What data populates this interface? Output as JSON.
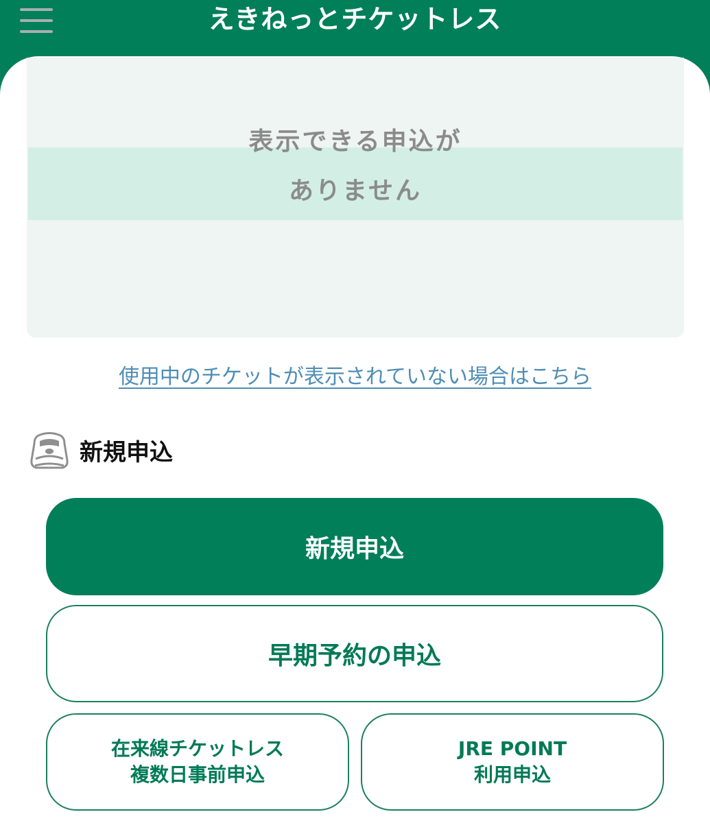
{
  "header": {
    "title": "えきねっとチケットレス",
    "menu_icon": "hamburger-menu-icon",
    "background_color": "#007f58"
  },
  "ticket_list": {
    "empty_message_line1": "表示できる申込が",
    "empty_message_line2": "ありません"
  },
  "help_link": {
    "label": "使用中のチケットが表示されていない場合はこちら"
  },
  "new_application_section": {
    "icon": "shinkansen-train-icon",
    "title": "新規申込",
    "buttons": {
      "new_application": "新規申込",
      "early_reservation": "早期予約の申込",
      "conventional_line_multi_day_line1": "在来線チケットレス",
      "conventional_line_multi_day_line2": "複数日事前申込",
      "jre_point_line1": "JRE POINT",
      "jre_point_line2": "利用申込"
    }
  },
  "colors": {
    "brand_green": "#007f58",
    "empty_card": "#eff5f2",
    "empty_highlight": "#d3efe5",
    "link": "#4e8db5"
  }
}
